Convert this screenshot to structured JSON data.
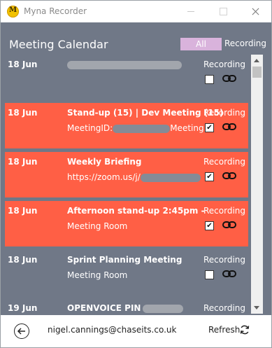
{
  "window": {
    "title": "Myna Recorder",
    "logo_letter": "M"
  },
  "header": {
    "title": "Meeting Calendar",
    "filter_all": "All",
    "filter_recording": "Recording"
  },
  "meetings": [
    {
      "date": "18 Jun",
      "title": "",
      "subtitle": "",
      "recording_label": "Recording",
      "recording": false,
      "highlighted": false
    },
    {
      "date": "18 Jun",
      "title": "Stand-up (15) | Dev Meeting (15)",
      "subtitle": "MeetingID:",
      "subtitle_suffix": "Meeting",
      "recording_label": "Recording",
      "recording": true,
      "highlighted": true
    },
    {
      "date": "18 Jun",
      "title": "Weekly Briefing",
      "subtitle": "https://zoom.us/j/",
      "recording_label": "Recording",
      "recording": true,
      "highlighted": true
    },
    {
      "date": "18 Jun",
      "title": "Afternoon stand-up 2:45pm -",
      "subtitle": "Meeting Room",
      "recording_label": "Recording",
      "recording": true,
      "highlighted": true
    },
    {
      "date": "18 Jun",
      "title": "Sprint Planning Meeting",
      "subtitle": "Meeting Room",
      "recording_label": "Recording",
      "recording": false,
      "highlighted": false
    },
    {
      "date": "19 Jun",
      "title": "OPENVOICE PIN",
      "subtitle": "",
      "recording_label": "Recording",
      "recording": false,
      "highlighted": false
    }
  ],
  "footer": {
    "email": "nigel.cannings@chaseits.co.uk",
    "refresh_label": "Refresh"
  },
  "icons": {
    "back": "arrow-left-circle-icon",
    "link": "link-icon",
    "refresh": "refresh-icon",
    "checked_glyph": "✔"
  },
  "colors": {
    "panel": "#707887",
    "highlight": "#ff5f45",
    "filter_all": "#d9b3dc"
  }
}
